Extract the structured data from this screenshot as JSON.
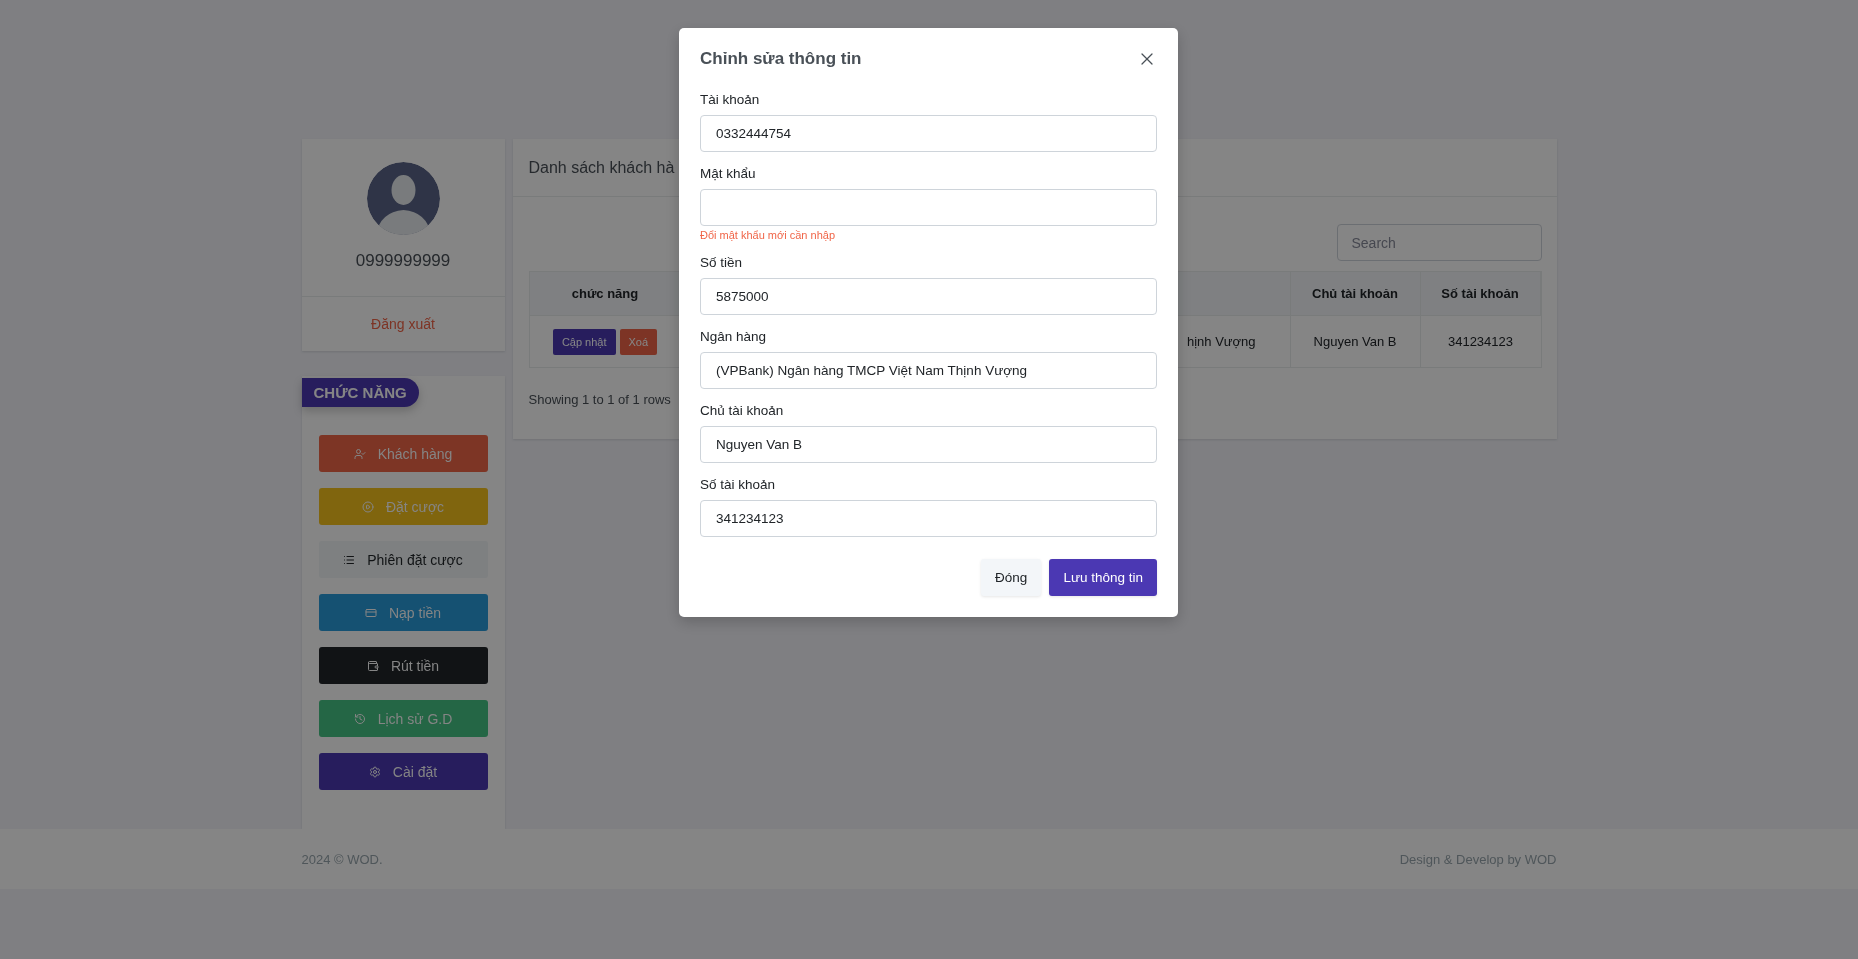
{
  "profile": {
    "phone": "0999999999",
    "logout": "Đăng xuất"
  },
  "menu": {
    "title": "CHỨC NĂNG",
    "items": [
      {
        "label": "Khách hàng",
        "color": "#7d3525"
      },
      {
        "label": "Đặt cược",
        "color": "#80650e"
      },
      {
        "label": "Phiên đặt cược",
        "color": "#7e8081"
      },
      {
        "label": "Nạp tiền",
        "color": "#155172"
      },
      {
        "label": "Rút tiền",
        "color": "#111315"
      },
      {
        "label": "Lịch sử G.D",
        "color": "#246645"
      },
      {
        "label": "Cài đặt",
        "color": "#271d5d"
      }
    ]
  },
  "table": {
    "title": "Danh sách khách hà",
    "search": {
      "placeholder": "Search"
    },
    "columns": [
      {
        "label": "chức năng"
      },
      {
        "label": "Chủ tài khoản"
      },
      {
        "label": "Số tài khoản"
      }
    ],
    "rows": [
      {
        "actions": [
          {
            "label": "Cập nhật",
            "kind": "primary"
          },
          {
            "label": "Xoá",
            "kind": "danger"
          }
        ],
        "column_3": "hịnh Vượng",
        "owner": "Nguyen Van B",
        "account": "341234123"
      }
    ],
    "pagination": "Showing 1 to 1 of 1 rows"
  },
  "footer": {
    "left": "2024 © WOD.",
    "right": "Design & Develop by WOD"
  },
  "modal": {
    "title": "Chỉnh sửa thông tin",
    "fields": [
      {
        "label": "Tài khoản",
        "value": "0332444754"
      },
      {
        "label": "Mật khẩu",
        "hint": "Đổi mật khẩu mới cần nhập"
      },
      {
        "label": "Số tiền",
        "value": "5875000"
      },
      {
        "label": "Ngân hàng",
        "value": "(VPBank) Ngân hàng TMCP Việt Nam Thịnh Vượng"
      },
      {
        "label": "Chủ tài khoản",
        "value": "Nguyen Van B"
      },
      {
        "label": "Số tài khoản",
        "value": "341234123"
      }
    ],
    "buttons": [
      {
        "label": "Đóng",
        "kind": "secondary"
      },
      {
        "label": "Lưu thông tin",
        "kind": "primary"
      }
    ]
  }
}
